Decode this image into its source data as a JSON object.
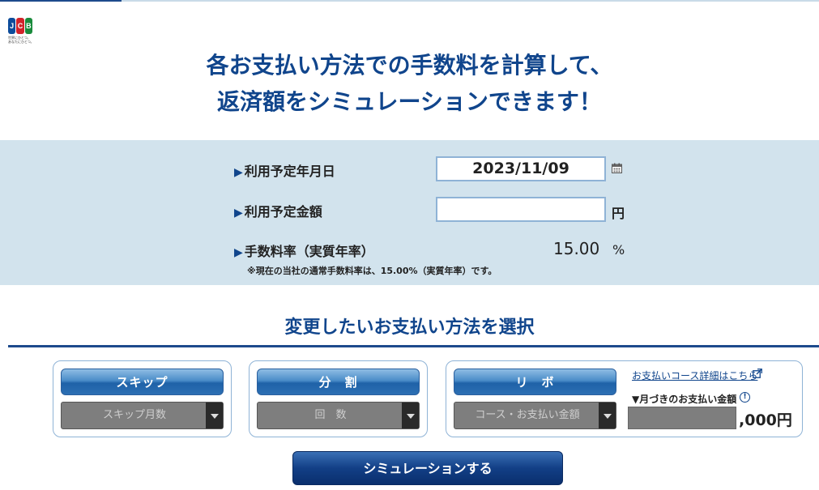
{
  "brand": {
    "logo_letters": [
      "J",
      "C",
      "B"
    ],
    "tagline_line1": "世界にひとつ。",
    "tagline_line2": "あなたにひとつ。"
  },
  "headline": {
    "line1": "各お支払い方法での手数料を計算して、",
    "line2": "返済額をシミュレーションできます！"
  },
  "form": {
    "date": {
      "label": "利用予定年月日",
      "value": "2023/11/09"
    },
    "amount": {
      "label": "利用予定金額",
      "value": "",
      "unit": "円"
    },
    "rate": {
      "label": "手数料率（実質年率）",
      "value": "15.00",
      "unit": "%"
    },
    "note": "※現在の当社の通常手数料率は、15.00%（実質年率）です。"
  },
  "section": {
    "title": "変更したいお支払い方法を選択"
  },
  "options": {
    "skip": {
      "button": "スキップ",
      "select_placeholder": "スキップ月数"
    },
    "split": {
      "button": "分　割",
      "select_placeholder": "回　数"
    },
    "revo": {
      "button": "リ　ボ",
      "select_placeholder": "コース・お支払い金額",
      "detail_link": "お支払いコース詳細はこちら",
      "monthly_label": "▼月づきのお支払い金額",
      "monthly_value": "",
      "monthly_suffix": ",000円"
    }
  },
  "actions": {
    "simulate": "シミュレーションする"
  },
  "colors": {
    "brand_blue": "#10458c",
    "band": "#d2e3ed"
  }
}
